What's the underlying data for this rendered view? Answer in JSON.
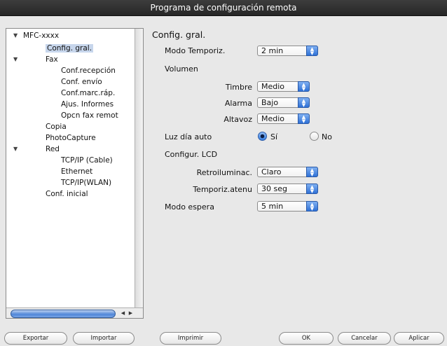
{
  "window": {
    "title": "Programa de configuración remota"
  },
  "tree": {
    "root": "MFC-xxxx",
    "items": [
      "Config. gral.",
      "Fax",
      "Conf.recepción",
      "Conf. envío",
      "Conf.marc.ráp.",
      "Ajus. Informes",
      "Opcn fax remot",
      "Copia",
      "PhotoCapture",
      "Red",
      "TCP/IP (Cable)",
      "Ethernet",
      "TCP/IP(WLAN)",
      "Conf. inicial"
    ]
  },
  "panel": {
    "title": "Config. gral.",
    "modo_temporiz": {
      "label": "Modo Temporiz.",
      "value": "2 min"
    },
    "volumen": {
      "label": "Volumen"
    },
    "timbre": {
      "label": "Timbre",
      "value": "Medio"
    },
    "alarma": {
      "label": "Alarma",
      "value": "Bajo"
    },
    "altavoz": {
      "label": "Altavoz",
      "value": "Medio"
    },
    "luz_dia": {
      "label": "Luz día auto",
      "option_si": "Sí",
      "option_no": "No",
      "selected": "Sí"
    },
    "lcd": {
      "label": "Configur. LCD"
    },
    "retroilum": {
      "label": "Retroiluminac.",
      "value": "Claro"
    },
    "temporiz_atenu": {
      "label": "Temporiz.atenu",
      "value": "30 seg"
    },
    "modo_espera": {
      "label": "Modo espera",
      "value": "5 min"
    }
  },
  "buttons": {
    "exportar": "Exportar",
    "importar": "Importar",
    "imprimir": "Imprimir",
    "ok": "OK",
    "cancelar": "Cancelar",
    "aplicar": "Aplicar"
  }
}
